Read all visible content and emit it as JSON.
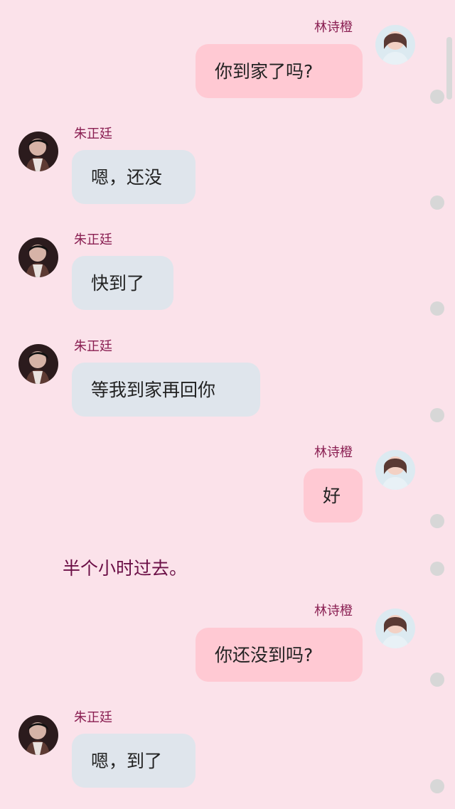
{
  "participants": {
    "self_name": "林诗橙",
    "other_name": "朱正廷"
  },
  "narration": "半个小时过去。",
  "messages": [
    {
      "sender": "林诗橙",
      "text": "你到家了吗?"
    },
    {
      "sender": "朱正廷",
      "text": "嗯，还没"
    },
    {
      "sender": "朱正廷",
      "text": "快到了"
    },
    {
      "sender": "朱正廷",
      "text": "等我到家再回你"
    },
    {
      "sender": "林诗橙",
      "text": "好"
    },
    {
      "sender": "林诗橙",
      "text": "你还没到吗?"
    },
    {
      "sender": "朱正廷",
      "text": "嗯，到了"
    }
  ],
  "colors": {
    "background": "#fbe2ea",
    "bubble_left": "#dfe5ec",
    "bubble_right": "#ffc9d3",
    "name": "#8a1f52",
    "narration": "#6b0f46"
  },
  "icons": {
    "right_avatar": "female-avatar-icon",
    "left_avatar": "male-avatar-icon",
    "dot": "indicator-dot-icon"
  }
}
